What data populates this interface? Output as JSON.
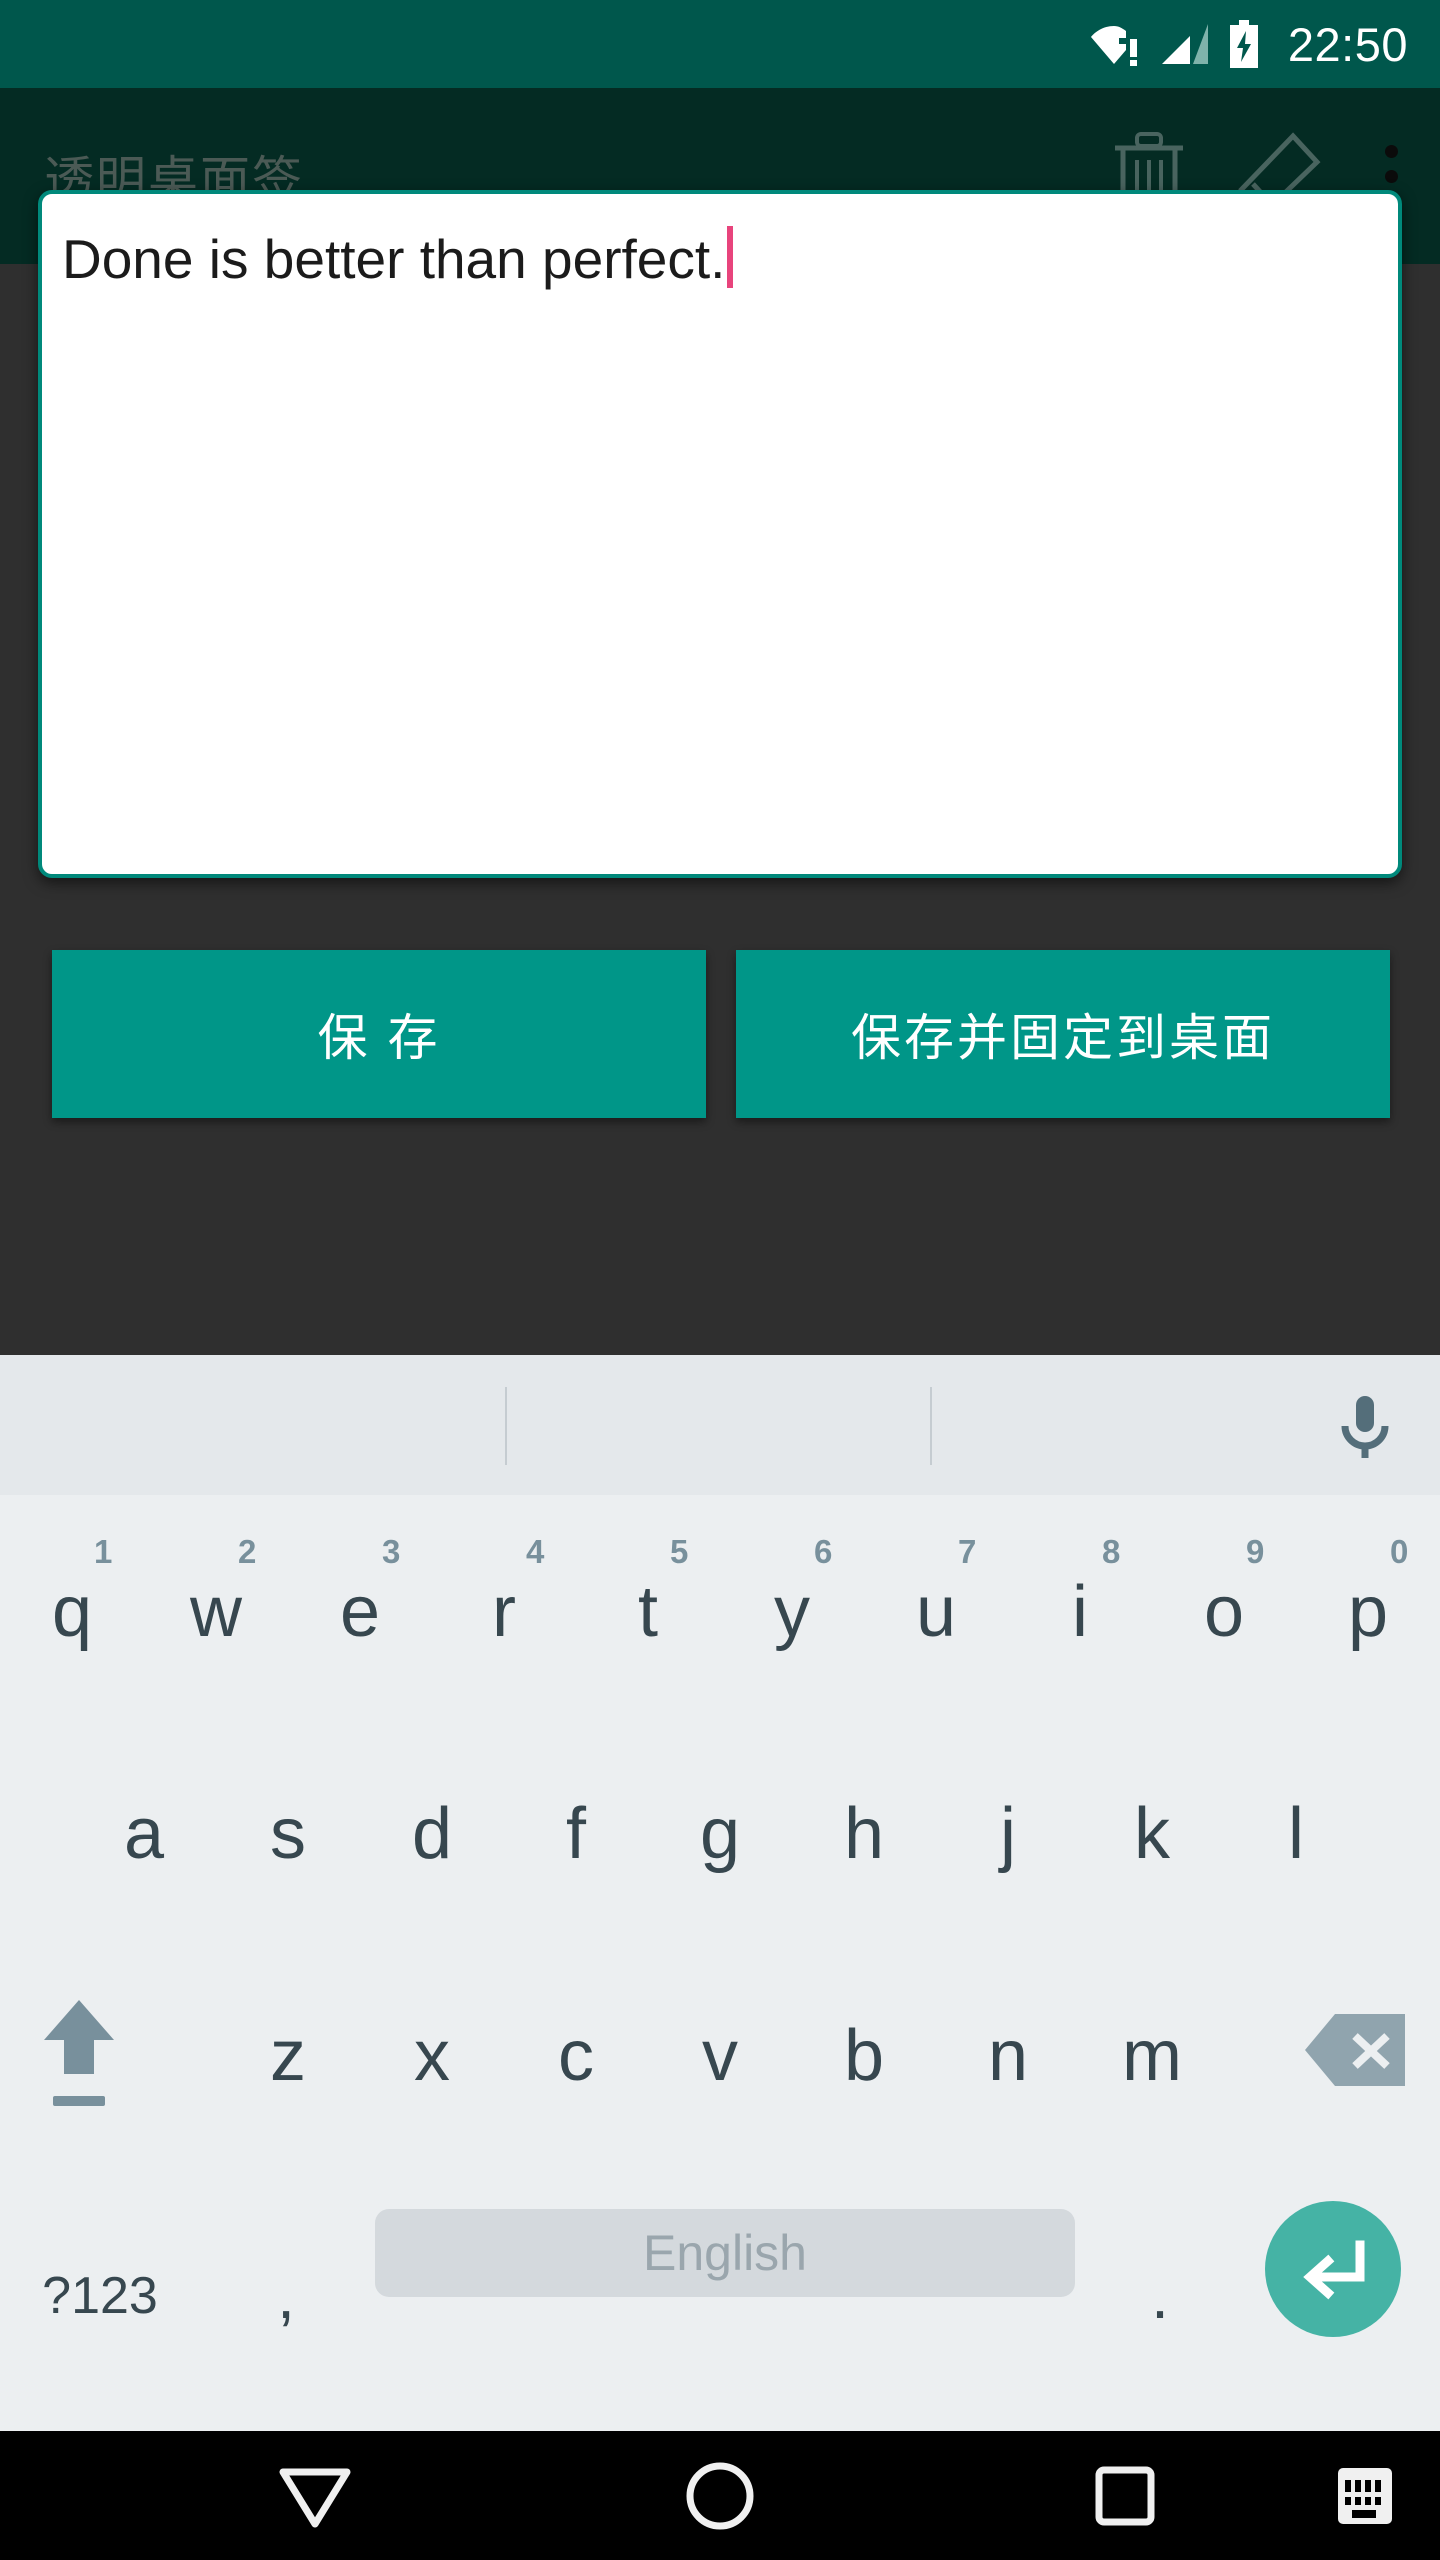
{
  "status_bar": {
    "time": "22:50",
    "icons": [
      "wifi-alert-icon",
      "cellular-signal-icon",
      "battery-charging-icon"
    ],
    "background_color": "#00574c"
  },
  "app_screen": {
    "title": "透明桌面签",
    "background_color": "#2f2f2f",
    "app_bar_color": "#042b23",
    "actions": [
      {
        "name": "delete-icon",
        "label": "删除"
      },
      {
        "name": "edit-icon",
        "label": "编辑"
      },
      {
        "name": "overflow-icon",
        "label": "更多"
      }
    ]
  },
  "dialog": {
    "note_text": "Done is better than perfect.",
    "caret_color": "#e8447c",
    "input_border_color": "#00897b",
    "buttons": {
      "save_label": "保 存",
      "save_pin_label": "保存并固定到桌面",
      "color": "#009688"
    }
  },
  "keyboard": {
    "background_color": "#eceff1",
    "suggestion_strip": {
      "suggestions": [
        "",
        "",
        ""
      ],
      "mic_icon": "microphone-icon"
    },
    "row_1": [
      {
        "letter": "q",
        "num": "1"
      },
      {
        "letter": "w",
        "num": "2"
      },
      {
        "letter": "e",
        "num": "3"
      },
      {
        "letter": "r",
        "num": "4"
      },
      {
        "letter": "t",
        "num": "5"
      },
      {
        "letter": "y",
        "num": "6"
      },
      {
        "letter": "u",
        "num": "7"
      },
      {
        "letter": "i",
        "num": "8"
      },
      {
        "letter": "o",
        "num": "9"
      },
      {
        "letter": "p",
        "num": "0"
      }
    ],
    "row_2": [
      {
        "letter": "a"
      },
      {
        "letter": "s"
      },
      {
        "letter": "d"
      },
      {
        "letter": "f"
      },
      {
        "letter": "g"
      },
      {
        "letter": "h"
      },
      {
        "letter": "j"
      },
      {
        "letter": "k"
      },
      {
        "letter": "l"
      }
    ],
    "row_3": [
      {
        "letter": "z"
      },
      {
        "letter": "x"
      },
      {
        "letter": "c"
      },
      {
        "letter": "v"
      },
      {
        "letter": "b"
      },
      {
        "letter": "n"
      },
      {
        "letter": "m"
      }
    ],
    "row_4": {
      "symbols_label": "?123",
      "comma_label": ",",
      "space_label": "English",
      "period_label": ".",
      "enter_icon": "enter-key-icon",
      "enter_color": "#45b3a5"
    },
    "shift_icon": "shift-icon",
    "backspace_icon": "backspace-icon"
  },
  "nav_bar": {
    "background_color": "#000000",
    "buttons": [
      {
        "name": "back-icon"
      },
      {
        "name": "home-icon"
      },
      {
        "name": "recents-icon"
      },
      {
        "name": "keyboard-switch-icon"
      }
    ]
  }
}
